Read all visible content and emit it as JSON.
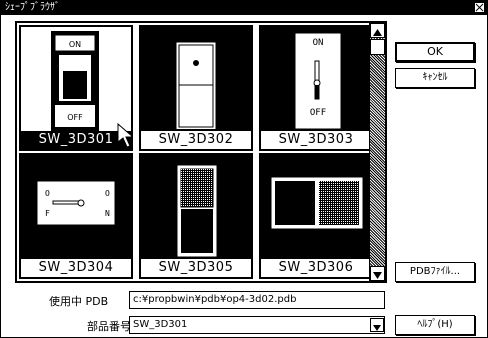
{
  "window": {
    "title": "ｼｪｰﾌﾟﾌﾞﾗｳｻﾞ"
  },
  "gallery": {
    "items": [
      {
        "label": "SW_3D301",
        "selected": true
      },
      {
        "label": "SW_3D302",
        "selected": false
      },
      {
        "label": "SW_3D303",
        "selected": false
      },
      {
        "label": "SW_3D304",
        "selected": false
      },
      {
        "label": "SW_3D305",
        "selected": false
      },
      {
        "label": "SW_3D306",
        "selected": false
      }
    ],
    "switch_texts": {
      "on": "ON",
      "off": "OFF",
      "o": "O",
      "n": "N",
      "f": "F"
    }
  },
  "buttons": {
    "ok": "OK",
    "cancel": "ｷｬﾝｾﾙ",
    "pdb_file": "PDBﾌｧｲﾙ...",
    "help": "ﾍﾙﾌﾟ(H)"
  },
  "fields": {
    "pdb_label": "使用中 PDB",
    "pdb_value": "c:¥propbwin¥pdb¥op4-3d02.pdb",
    "part_label": "部品番号",
    "part_value": "SW_3D301"
  }
}
